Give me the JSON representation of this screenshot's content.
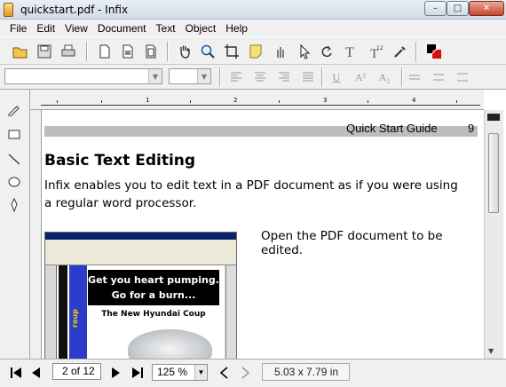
{
  "window": {
    "title": "quickstart.pdf - Infix",
    "minimize_glyph": "–",
    "maximize_glyph": "□",
    "close_glyph": "✕"
  },
  "menu": [
    "File",
    "Edit",
    "View",
    "Document",
    "Text",
    "Object",
    "Help"
  ],
  "toolbar": {
    "tools": [
      "open-icon",
      "save-icon",
      "print-icon",
      "page-icon",
      "page-insert-icon",
      "page-extract-icon",
      "hand-icon",
      "zoom-icon",
      "crop-icon",
      "note-icon",
      "pan-icon",
      "select-icon",
      "rotate-icon",
      "text-tool-icon",
      "text-flow-icon",
      "eyedropper-icon",
      "color-icon"
    ]
  },
  "format_bar": {
    "font_value": "",
    "size_value": "",
    "underline": "U",
    "superscript": "A²",
    "subscript": "A₂"
  },
  "ruler": {
    "labels": [
      "1",
      "2",
      "3",
      "4"
    ]
  },
  "document": {
    "header_title": "Quick Start Guide",
    "header_page": "9",
    "heading": "Basic Text Editing",
    "paragraph": "Infix enables you to edit text in a PDF document as if you were using a regular word processor.",
    "step": "Open the PDF document to be edited.",
    "screenshot": {
      "headline_line1": "Get you heart pumping.",
      "headline_line2": "Go for a burn...",
      "subheadline": "The New Hyundai Coup",
      "vertical_text": "roup"
    }
  },
  "statusbar": {
    "page_value": "2 of 12",
    "zoom_value": "125 %",
    "page_size": "5.03 x 7.79 in"
  },
  "colors": {
    "title_gradient_top": "#eaf0f7",
    "accent_blue": "#2a3dc8"
  }
}
